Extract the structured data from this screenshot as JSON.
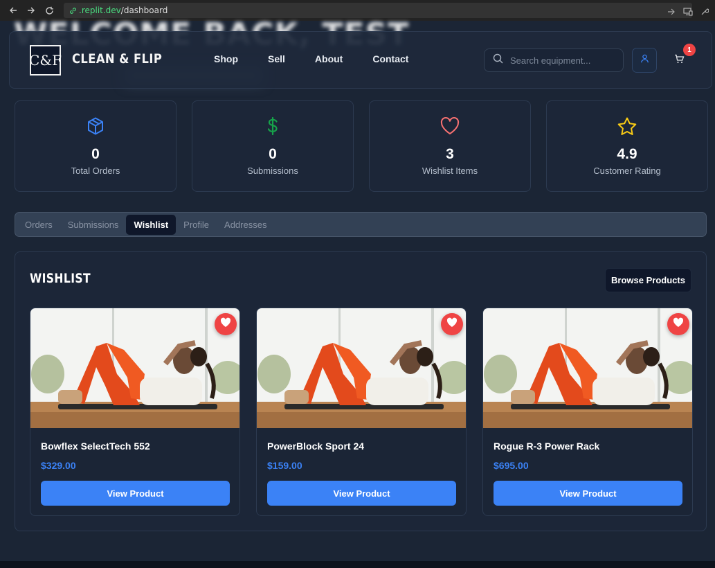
{
  "browser": {
    "url_host": ".replit.dev",
    "url_path": "/dashboard"
  },
  "page": {
    "heading": "WELCOME BACK, TEST"
  },
  "header": {
    "logo_text": "C&F",
    "brand": "CLEAN & FLIP",
    "nav": [
      "Shop",
      "Sell",
      "About",
      "Contact"
    ],
    "search_placeholder": "Search equipment...",
    "cart_count": "1"
  },
  "stats": [
    {
      "icon": "package-icon",
      "value": "0",
      "label": "Total Orders",
      "color": "#3b82f6"
    },
    {
      "icon": "dollar-icon",
      "value": "0",
      "label": "Submissions",
      "color": "#16a34a"
    },
    {
      "icon": "heart-icon",
      "value": "3",
      "label": "Wishlist Items",
      "color": "#f87171"
    },
    {
      "icon": "star-icon",
      "value": "4.9",
      "label": "Customer Rating",
      "color": "#facc15"
    }
  ],
  "tabs": [
    {
      "label": "Orders",
      "active": false
    },
    {
      "label": "Submissions",
      "active": false
    },
    {
      "label": "Wishlist",
      "active": true
    },
    {
      "label": "Profile",
      "active": false
    },
    {
      "label": "Addresses",
      "active": false
    }
  ],
  "wishlist": {
    "title": "WISHLIST",
    "browse_label": "Browse Products",
    "items": [
      {
        "name": "Bowflex SelectTech 552",
        "price": "$329.00",
        "button": "View Product"
      },
      {
        "name": "PowerBlock Sport 24",
        "price": "$159.00",
        "button": "View Product"
      },
      {
        "name": "Rogue R-3 Power Rack",
        "price": "$695.00",
        "button": "View Product"
      }
    ]
  },
  "colors": {
    "accent": "#3b82f6",
    "heart_badge": "#ef4444",
    "background": "#1b2535"
  }
}
